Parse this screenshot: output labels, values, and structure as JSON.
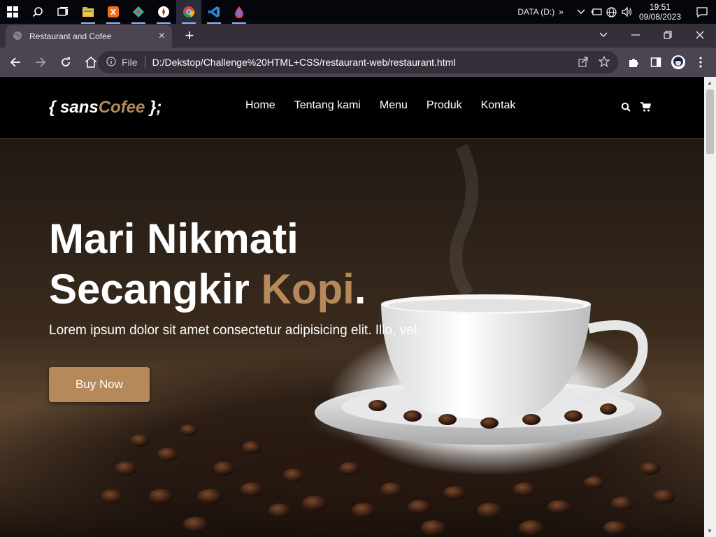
{
  "taskbar": {
    "tray_drive": "DATA (D:)",
    "tray_more": "»",
    "time": "19:51",
    "date": "09/08/2023"
  },
  "browser": {
    "tab_title": "Restaurant and Cofee",
    "tab_close": "×",
    "new_tab": "+",
    "address_scheme": "File",
    "address_url": "D:/Dekstop/Challenge%20HTML+CSS/restaurant-web/restaurant.html"
  },
  "site": {
    "logo_prefix": "{ sans",
    "logo_accent": "Cofee",
    "logo_suffix": " };",
    "nav": [
      "Home",
      "Tentang kami",
      "Menu",
      "Produk",
      "Kontak"
    ],
    "hero_line1": "Mari Nikmati",
    "hero_line2_start": "Secangkir ",
    "hero_line2_accent": "Kopi",
    "hero_line2_end": ".",
    "hero_sub": "Lorem ipsum dolor sit amet consectetur adipisicing elit. Illo, vel.",
    "buy_button": "Buy Now"
  },
  "colors": {
    "accent": "#b6895b",
    "header_bg": "#010101",
    "browser_chrome": "#4c4450",
    "tab_strip": "#352f3a"
  }
}
